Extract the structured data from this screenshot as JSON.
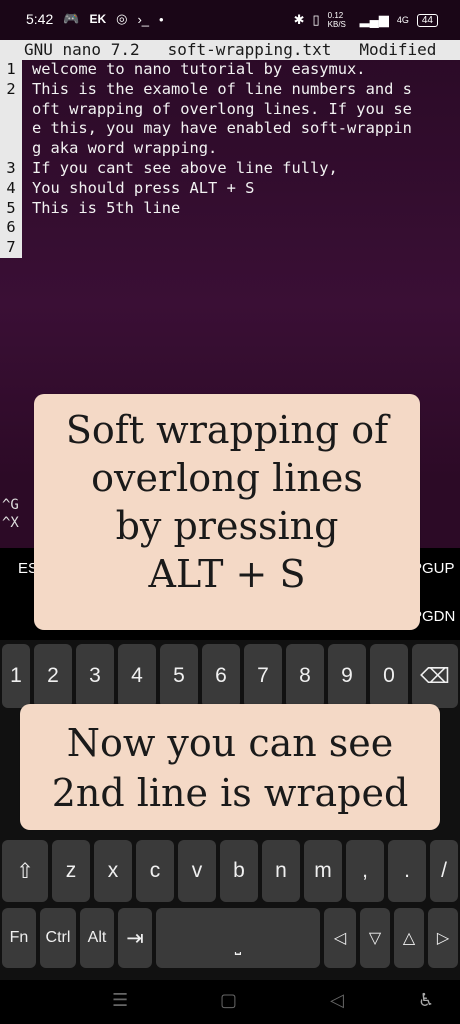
{
  "status_bar": {
    "time": "5:42",
    "apps": [
      "EK"
    ],
    "net_speed": "0.12 KB/S",
    "net_type": "4G",
    "battery": "44"
  },
  "nano": {
    "version": "GNU nano 7.2",
    "filename": "soft-wrapping.txt",
    "state": "Modified",
    "lines": [
      {
        "num": "1",
        "text": "welcome to nano tutorial by easymux."
      },
      {
        "num": "2",
        "text": "This is the examole of line numbers and s"
      },
      {
        "num": "",
        "text": "oft wrapping of overlong lines. If you se"
      },
      {
        "num": "",
        "text": "e this, you may have enabled soft-wrappin"
      },
      {
        "num": "",
        "text": "g aka word wrapping."
      },
      {
        "num": "3",
        "text": "If you cant see above line fully,"
      },
      {
        "num": "4",
        "text": "You should press ALT + S"
      },
      {
        "num": "5",
        "text": "This is 5th line"
      },
      {
        "num": "6",
        "text": ""
      },
      {
        "num": "7",
        "text": ""
      }
    ],
    "shortcuts": [
      "^G",
      "^X"
    ]
  },
  "extra_keys": {
    "esc": "ESC",
    "pgup": "PGUP",
    "pgdn": "PGDN"
  },
  "keyboard": {
    "number_row": [
      "1",
      "2",
      "3",
      "4",
      "5",
      "6",
      "7",
      "8",
      "9",
      "0"
    ],
    "bottom_letters": [
      "z",
      "x",
      "c",
      "v",
      "b",
      "n",
      "m",
      ",",
      ".",
      "/"
    ],
    "fn": "Fn",
    "ctrl": "Ctrl",
    "alt": "Alt"
  },
  "overlay_top": {
    "lines": [
      "Soft wrapping of",
      "overlong lines",
      "by pressing",
      "ALT + S"
    ]
  },
  "overlay_bottom": {
    "lines": [
      "Now you can see",
      "2nd line is wraped"
    ]
  }
}
